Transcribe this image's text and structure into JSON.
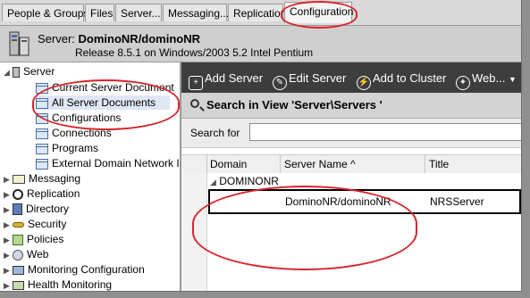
{
  "tabs": [
    {
      "label": "People & Groups"
    },
    {
      "label": "Files"
    },
    {
      "label": "Server..."
    },
    {
      "label": "Messaging..."
    },
    {
      "label": "Replication"
    },
    {
      "label": "Configuration"
    }
  ],
  "server": {
    "prefix": "Server:",
    "name": "DominoNR/dominoNR",
    "release": "Release 8.5.1 on Windows/2003 5.2 Intel Pentium"
  },
  "nav": {
    "root": "Server",
    "children": [
      "Current Server Document",
      "All Server Documents",
      "Configurations",
      "Connections",
      "Programs",
      "External Domain Network Inf"
    ],
    "sections": [
      "Messaging",
      "Replication",
      "Directory",
      "Security",
      "Policies",
      "Web",
      "Monitoring Configuration",
      "Health Monitoring"
    ]
  },
  "toolbar": {
    "add_server": "Add Server",
    "edit_server": "Edit Server",
    "add_to_cluster": "Add to Cluster",
    "web": "Web..."
  },
  "search": {
    "title": "Search in View 'Server\\Servers '",
    "label": "Search for",
    "value": ""
  },
  "view": {
    "columns": {
      "domain": "Domain",
      "server_name": "Server Name ^",
      "title": "Title"
    },
    "category": "DOMINONR",
    "row": {
      "server_name": "DominoNR/dominoNR",
      "title": "NRSServer"
    }
  },
  "colors": {
    "annotation": "#d8242a",
    "toolbar_bg": "#3d3d3d"
  }
}
